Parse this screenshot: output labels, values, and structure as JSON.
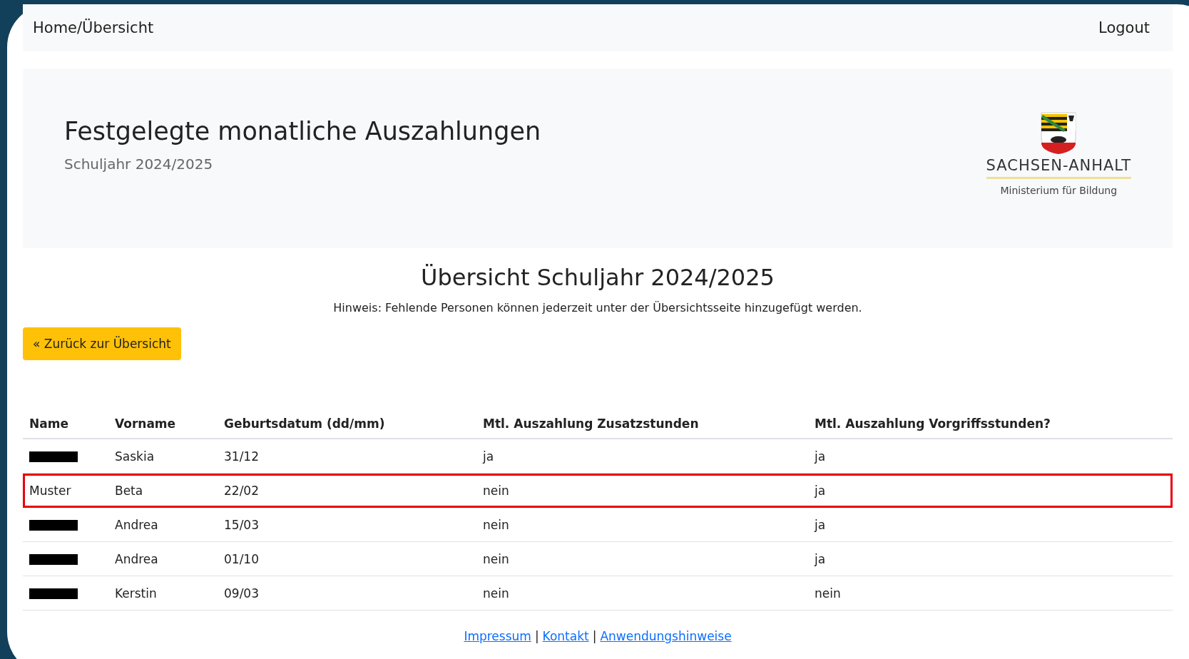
{
  "navbar": {
    "home": "Home/Übersicht",
    "logout": "Logout"
  },
  "header": {
    "title": "Festgelegte monatliche Auszahlungen",
    "subtitle": "Schuljahr 2024/2025",
    "logo_name": "SACHSEN-ANHALT",
    "logo_sub": "Ministerium für Bildung"
  },
  "heading": "Übersicht Schuljahr 2024/2025",
  "hint": "Hinweis: Fehlende Personen können jederzeit unter der Übersichtsseite hinzugefügt werden.",
  "back_button": "« Zurück zur Übersicht",
  "table": {
    "columns": [
      "Name",
      "Vorname",
      "Geburtsdatum (dd/mm)",
      "Mtl. Auszahlung Zusatzstunden",
      "Mtl. Auszahlung Vorgriffsstunden?"
    ],
    "rows": [
      {
        "redacted": true,
        "highlighted": false,
        "cells": [
          "",
          "Saskia",
          "31/12",
          "ja",
          "ja"
        ]
      },
      {
        "redacted": false,
        "highlighted": true,
        "cells": [
          "Muster",
          "Beta",
          "22/02",
          "nein",
          "ja"
        ]
      },
      {
        "redacted": true,
        "highlighted": false,
        "cells": [
          "",
          "Andrea",
          "15/03",
          "nein",
          "ja"
        ]
      },
      {
        "redacted": true,
        "highlighted": false,
        "cells": [
          "",
          "Andrea",
          "01/10",
          "nein",
          "ja"
        ]
      },
      {
        "redacted": true,
        "highlighted": false,
        "cells": [
          "",
          "Kerstin",
          "09/03",
          "nein",
          "nein"
        ]
      }
    ]
  },
  "footer": {
    "links": [
      "Impressum",
      "Kontakt",
      "Anwendungshinweise"
    ],
    "separator": "|"
  }
}
